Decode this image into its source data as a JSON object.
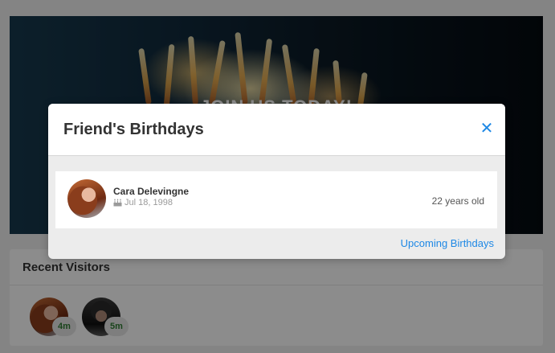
{
  "banner": {
    "text": "JOIN US TODAY!"
  },
  "recent_visitors": {
    "title": "Recent Visitors",
    "visitors": [
      {
        "time": "4m"
      },
      {
        "time": "5m"
      }
    ]
  },
  "modal": {
    "title": "Friend's Birthdays",
    "close_label": "✕",
    "birthdays": [
      {
        "name": "Cara Delevingne",
        "date": "Jul 18, 1998",
        "age": "22 years old"
      }
    ],
    "footer_link": "Upcoming Birthdays"
  },
  "colors": {
    "accent": "#1e88e5",
    "visitor_time": "#2e7d32"
  }
}
